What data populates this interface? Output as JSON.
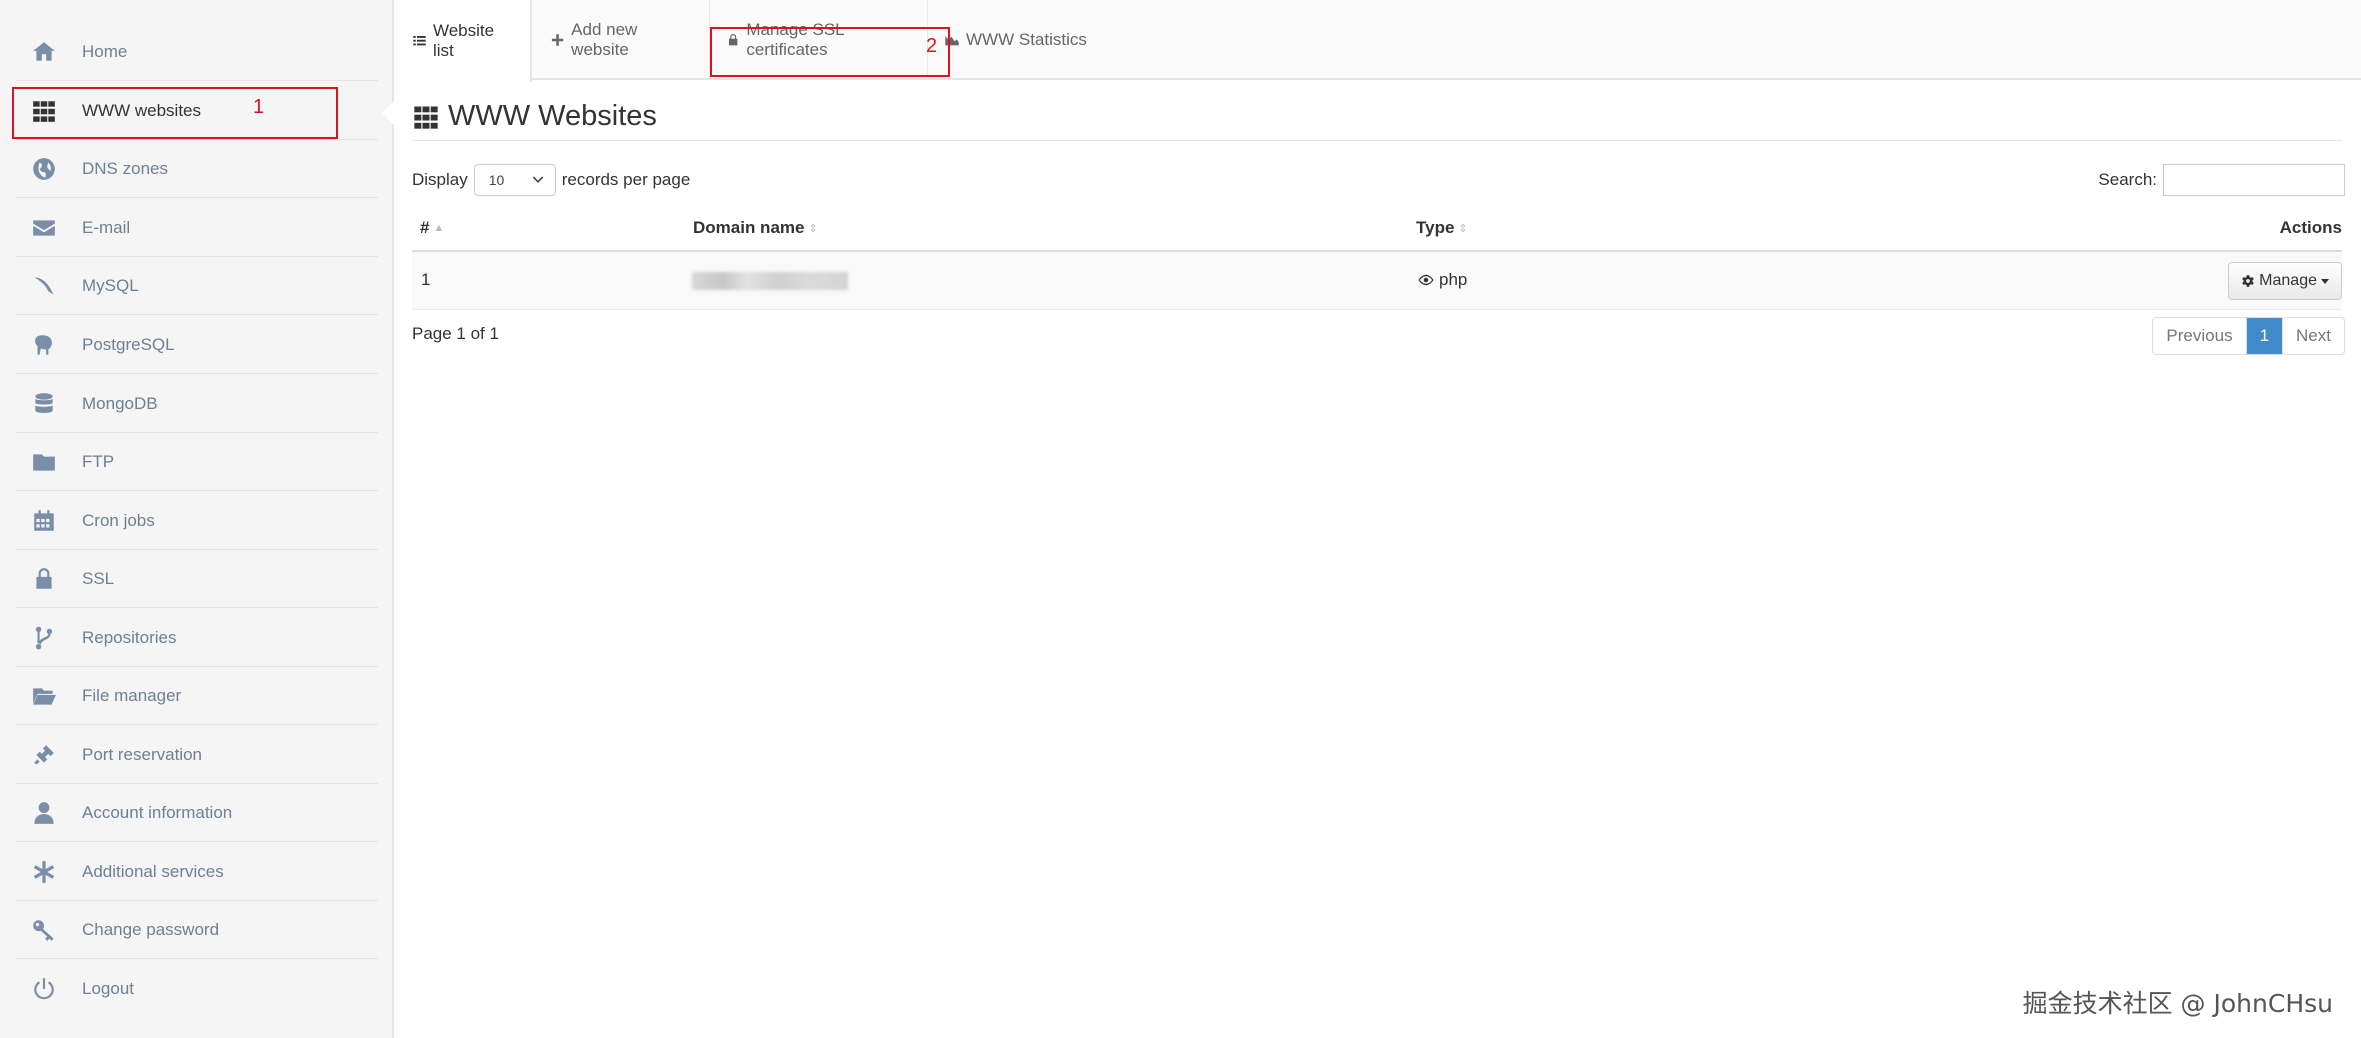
{
  "sidebar": {
    "items": [
      {
        "label": "Home",
        "icon": "home-icon"
      },
      {
        "label": "WWW websites",
        "icon": "grid-icon"
      },
      {
        "label": "DNS zones",
        "icon": "globe-icon"
      },
      {
        "label": "E-mail",
        "icon": "envelope-icon"
      },
      {
        "label": "MySQL",
        "icon": "dolphin-icon"
      },
      {
        "label": "PostgreSQL",
        "icon": "elephant-icon"
      },
      {
        "label": "MongoDB",
        "icon": "database-icon"
      },
      {
        "label": "FTP",
        "icon": "folder-icon"
      },
      {
        "label": "Cron jobs",
        "icon": "calendar-icon"
      },
      {
        "label": "SSL",
        "icon": "lock-icon"
      },
      {
        "label": "Repositories",
        "icon": "branch-icon"
      },
      {
        "label": "File manager",
        "icon": "folder-open-icon"
      },
      {
        "label": "Port reservation",
        "icon": "plug-icon"
      },
      {
        "label": "Account information",
        "icon": "user-icon"
      },
      {
        "label": "Additional services",
        "icon": "asterisk-icon"
      },
      {
        "label": "Change password",
        "icon": "key-icon"
      },
      {
        "label": "Logout",
        "icon": "power-icon"
      }
    ],
    "active": "WWW websites"
  },
  "tabs": [
    {
      "label": "Website list",
      "icon": "list-icon"
    },
    {
      "label": "Add new website",
      "icon": "plus-icon"
    },
    {
      "label": "Manage SSL certificates",
      "icon": "lock-icon"
    },
    {
      "label": "WWW Statistics",
      "icon": "area-chart-icon"
    }
  ],
  "page": {
    "title": "WWW Websites"
  },
  "controls": {
    "display_label": "Display",
    "per_page_value": "10",
    "records_label": "records per page",
    "search_label": "Search:",
    "search_value": ""
  },
  "table": {
    "columns": [
      "#",
      "Domain name",
      "Type",
      "Actions"
    ],
    "rows": [
      {
        "index": "1",
        "domain": "",
        "type": "php",
        "action": "Manage"
      }
    ]
  },
  "footer": {
    "page_info": "Page 1 of 1",
    "prev": "Previous",
    "current": "1",
    "next": "Next"
  },
  "annotations": {
    "one": "1",
    "two": "2"
  },
  "watermark": "掘金技术社区 @ JohnCHsu",
  "colors": {
    "accent": "#428bca",
    "annotation": "#d9141e",
    "sidebar_bg": "#f5f5f5"
  }
}
